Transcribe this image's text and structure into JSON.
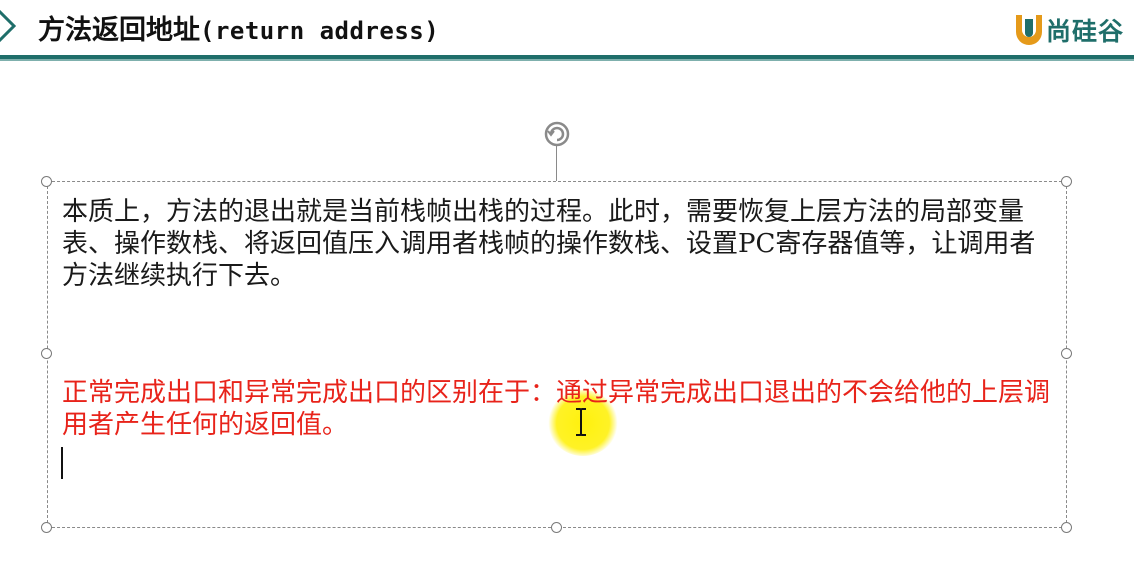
{
  "slide": {
    "title_cn": "方法返回地址",
    "title_en": "(return address)"
  },
  "logo": {
    "text": "尚硅谷"
  },
  "textbox": {
    "paragraph_1": "本质上，方法的退出就是当前栈帧出栈的过程。此时，需要恢复上层方法的局部变量表、操作数栈、将返回值压入调用者栈帧的操作数栈、设置PC寄存器值等，让调用者方法继续执行下去。",
    "paragraph_2": "正常完成出口和异常完成出口的区别在于：通过异常完成出口退出的不会给他的上层调用者产生任何的返回值。"
  },
  "colors": {
    "accent": "#1f6e6a",
    "logo_orange": "#e59a1a",
    "red_text": "#e8231a",
    "cursor_highlight": "#fff000"
  },
  "icons": {
    "header_arrow": "chevron-right-icon",
    "rotate": "rotate-handle-icon",
    "cursor": "i-beam-cursor-icon"
  }
}
